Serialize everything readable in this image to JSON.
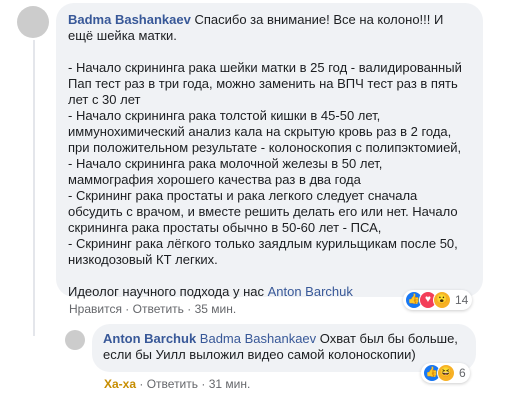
{
  "comment1": {
    "author": "Badma Bashankaev",
    "text": " Спасибо за внимание! Все на колоно!!! И ещё шейка матки.\n\n- Начало скрининга рака шейки матки в 25 год - валидированный Пап тест раз в три года, можно заменить на ВПЧ тест раз в пять лет с 30 лет\n- Начало скрининга рака толстой кишки в 45-50 лет, иммунохимический анализ кала на скрытую кровь раз в 2 года, при положительном результате - колоноскопия с полипэктомией,\n- Начало скрининга рака молочной железы в 50 лет, маммография хорошего качества раз в два года\n- Скрининг рака простаты и рака легкого следует сначала обсудить с врачом, и вместе решить делать его или нет. Начало скрининга рака простаты обычно в 50-60 лет - ПСА,\n- Скрининг рака лёгкого только заядлым курильщикам после 50, низкодозовый КТ легких.\n\nИдеолог научного подхода у нас ",
    "link": "Anton Barchuk",
    "actions": {
      "like": "Нравится",
      "reply": "Ответить",
      "time": "35 мин."
    },
    "reactions": {
      "icons": [
        "like-icon",
        "love-icon",
        "wow-icon"
      ],
      "count": "14"
    }
  },
  "comment2": {
    "author": "Anton Barchuk",
    "mention": "Badma Bashankaev",
    "text": " Охват был бы больше, если бы Уилл выложил видео самой колоноскопии)",
    "actions": {
      "reaction": "Ха-ха",
      "reply": "Ответить",
      "time": "31 мин."
    },
    "reactions": {
      "icons": [
        "like-icon",
        "haha-icon"
      ],
      "count": "6"
    }
  },
  "colors": {
    "link": "#385898",
    "bubble": "#f0f2f5",
    "muted": "#65676b",
    "haha": "#c78d00"
  }
}
